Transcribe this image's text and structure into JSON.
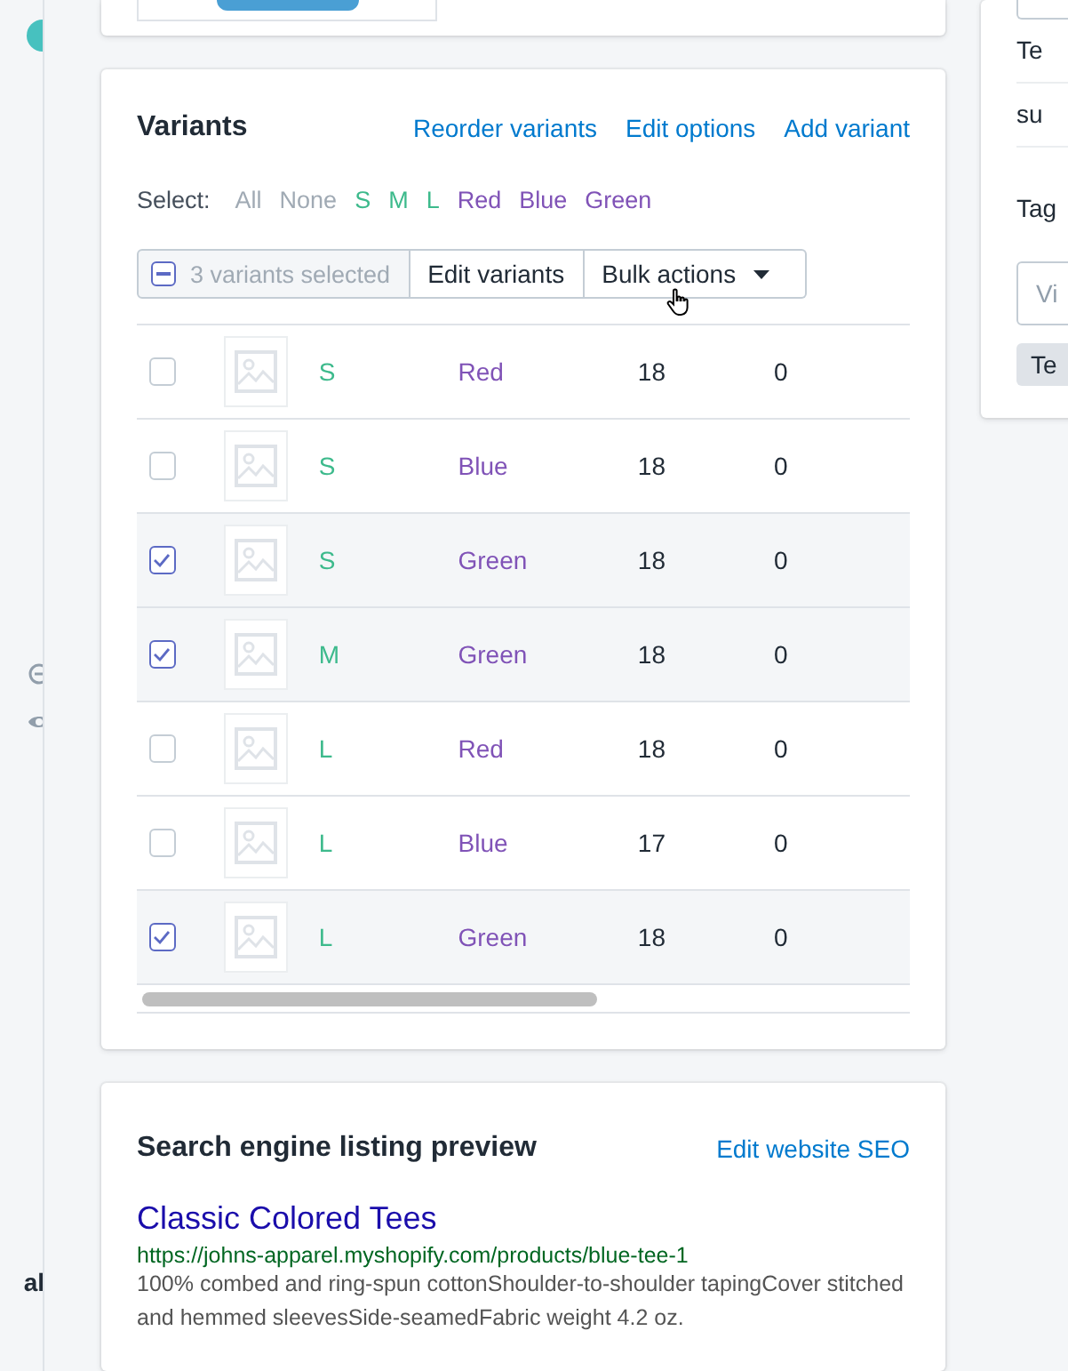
{
  "sidebar": {
    "footer_text": "al"
  },
  "variants": {
    "title": "Variants",
    "actions": [
      "Reorder variants",
      "Edit options",
      "Add variant"
    ],
    "select": {
      "label": "Select:",
      "options": [
        {
          "label": "All",
          "kind": "general"
        },
        {
          "label": "None",
          "kind": "general"
        },
        {
          "label": "S",
          "kind": "size"
        },
        {
          "label": "M",
          "kind": "size"
        },
        {
          "label": "L",
          "kind": "size"
        },
        {
          "label": "Red",
          "kind": "color"
        },
        {
          "label": "Blue",
          "kind": "color"
        },
        {
          "label": "Green",
          "kind": "color"
        }
      ]
    },
    "toolbar": {
      "indeterminate": true,
      "count_label": "3 variants selected",
      "edit_button": "Edit variants",
      "bulk_button": "Bulk actions"
    },
    "rows": [
      {
        "checked": false,
        "option_1": "S",
        "option_2": "Red",
        "column_5": "18",
        "column_6": "0"
      },
      {
        "checked": false,
        "option_1": "S",
        "option_2": "Blue",
        "column_5": "18",
        "column_6": "0"
      },
      {
        "checked": true,
        "option_1": "S",
        "option_2": "Green",
        "column_5": "18",
        "column_6": "0"
      },
      {
        "checked": true,
        "option_1": "M",
        "option_2": "Green",
        "column_5": "18",
        "column_6": "0"
      },
      {
        "checked": false,
        "option_1": "L",
        "option_2": "Red",
        "column_5": "18",
        "column_6": "0"
      },
      {
        "checked": false,
        "option_1": "L",
        "option_2": "Blue",
        "column_5": "17",
        "column_6": "0"
      },
      {
        "checked": true,
        "option_1": "L",
        "option_2": "Green",
        "column_5": "18",
        "column_6": "0"
      }
    ]
  },
  "seo": {
    "title": "Search engine listing preview",
    "action": "Edit website SEO",
    "page_title": "Classic Colored Tees",
    "url": "https://johns-apparel.myshopify.com/products/blue-tee-1",
    "description": "100% combed and ring-spun cottonShoulder-to-shoulder tapingCover stitched and hemmed sleevesSide-seamedFabric weight 4.2 oz."
  },
  "right_panel": {
    "list_items": [
      "Te",
      "su"
    ],
    "tags_title": "Tag",
    "tags_placeholder": "Vi",
    "tag": "Te"
  }
}
